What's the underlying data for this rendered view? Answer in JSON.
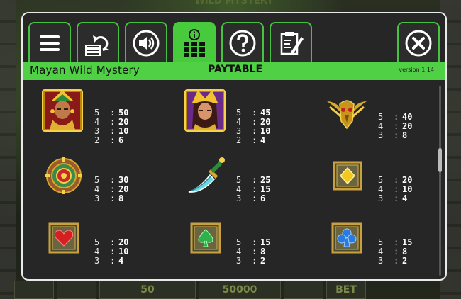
{
  "background": {
    "title": "WILD MYSTERY",
    "bet_box_1": "50",
    "bet_box_2": "50000",
    "bet_label": "BET"
  },
  "tabs": [
    {
      "name": "menu",
      "icon": "menu-icon"
    },
    {
      "name": "autoplay",
      "icon": "autoplay-icon"
    },
    {
      "name": "sound",
      "icon": "sound-icon"
    },
    {
      "name": "paytable",
      "icon": "paytable-icon",
      "active": true
    },
    {
      "name": "help",
      "icon": "help-icon"
    },
    {
      "name": "history",
      "icon": "history-icon"
    },
    {
      "name": "close",
      "icon": "close-icon"
    }
  ],
  "header": {
    "game_name": "Mayan Wild Mystery",
    "section_title": "PAYTABLE",
    "version": "version 1.14"
  },
  "colors": {
    "accent_green": "#4fd045",
    "panel_bg": "#262626",
    "panel_border": "#e9e9e9"
  },
  "symbols": [
    {
      "id": "warrior",
      "icon": "mayan-warrior-icon",
      "payouts": [
        {
          "count": "5",
          "value": "50"
        },
        {
          "count": "4",
          "value": "20"
        },
        {
          "count": "3",
          "value": "10"
        },
        {
          "count": "2",
          "value": "6"
        }
      ]
    },
    {
      "id": "princess",
      "icon": "mayan-princess-icon",
      "payouts": [
        {
          "count": "5",
          "value": "45"
        },
        {
          "count": "4",
          "value": "20"
        },
        {
          "count": "3",
          "value": "10"
        },
        {
          "count": "2",
          "value": "4"
        }
      ]
    },
    {
      "id": "bird",
      "icon": "golden-bird-icon",
      "payouts": [
        {
          "count": "5",
          "value": "40"
        },
        {
          "count": "4",
          "value": "20"
        },
        {
          "count": "3",
          "value": "8"
        }
      ]
    },
    {
      "id": "calendar",
      "icon": "mayan-calendar-icon",
      "payouts": [
        {
          "count": "5",
          "value": "30"
        },
        {
          "count": "4",
          "value": "20"
        },
        {
          "count": "3",
          "value": "8"
        }
      ]
    },
    {
      "id": "dagger",
      "icon": "dagger-icon",
      "payouts": [
        {
          "count": "5",
          "value": "25"
        },
        {
          "count": "4",
          "value": "15"
        },
        {
          "count": "3",
          "value": "6"
        }
      ]
    },
    {
      "id": "diamond",
      "icon": "diamond-tile-icon",
      "payouts": [
        {
          "count": "5",
          "value": "20"
        },
        {
          "count": "4",
          "value": "10"
        },
        {
          "count": "3",
          "value": "4"
        }
      ]
    },
    {
      "id": "heart",
      "icon": "heart-tile-icon",
      "payouts": [
        {
          "count": "5",
          "value": "20"
        },
        {
          "count": "4",
          "value": "10"
        },
        {
          "count": "3",
          "value": "4"
        }
      ]
    },
    {
      "id": "spade",
      "icon": "spade-tile-icon",
      "payouts": [
        {
          "count": "5",
          "value": "15"
        },
        {
          "count": "4",
          "value": "8"
        },
        {
          "count": "3",
          "value": "2"
        }
      ]
    },
    {
      "id": "club",
      "icon": "club-tile-icon",
      "payouts": [
        {
          "count": "5",
          "value": "15"
        },
        {
          "count": "4",
          "value": "8"
        },
        {
          "count": "3",
          "value": "2"
        }
      ]
    }
  ]
}
